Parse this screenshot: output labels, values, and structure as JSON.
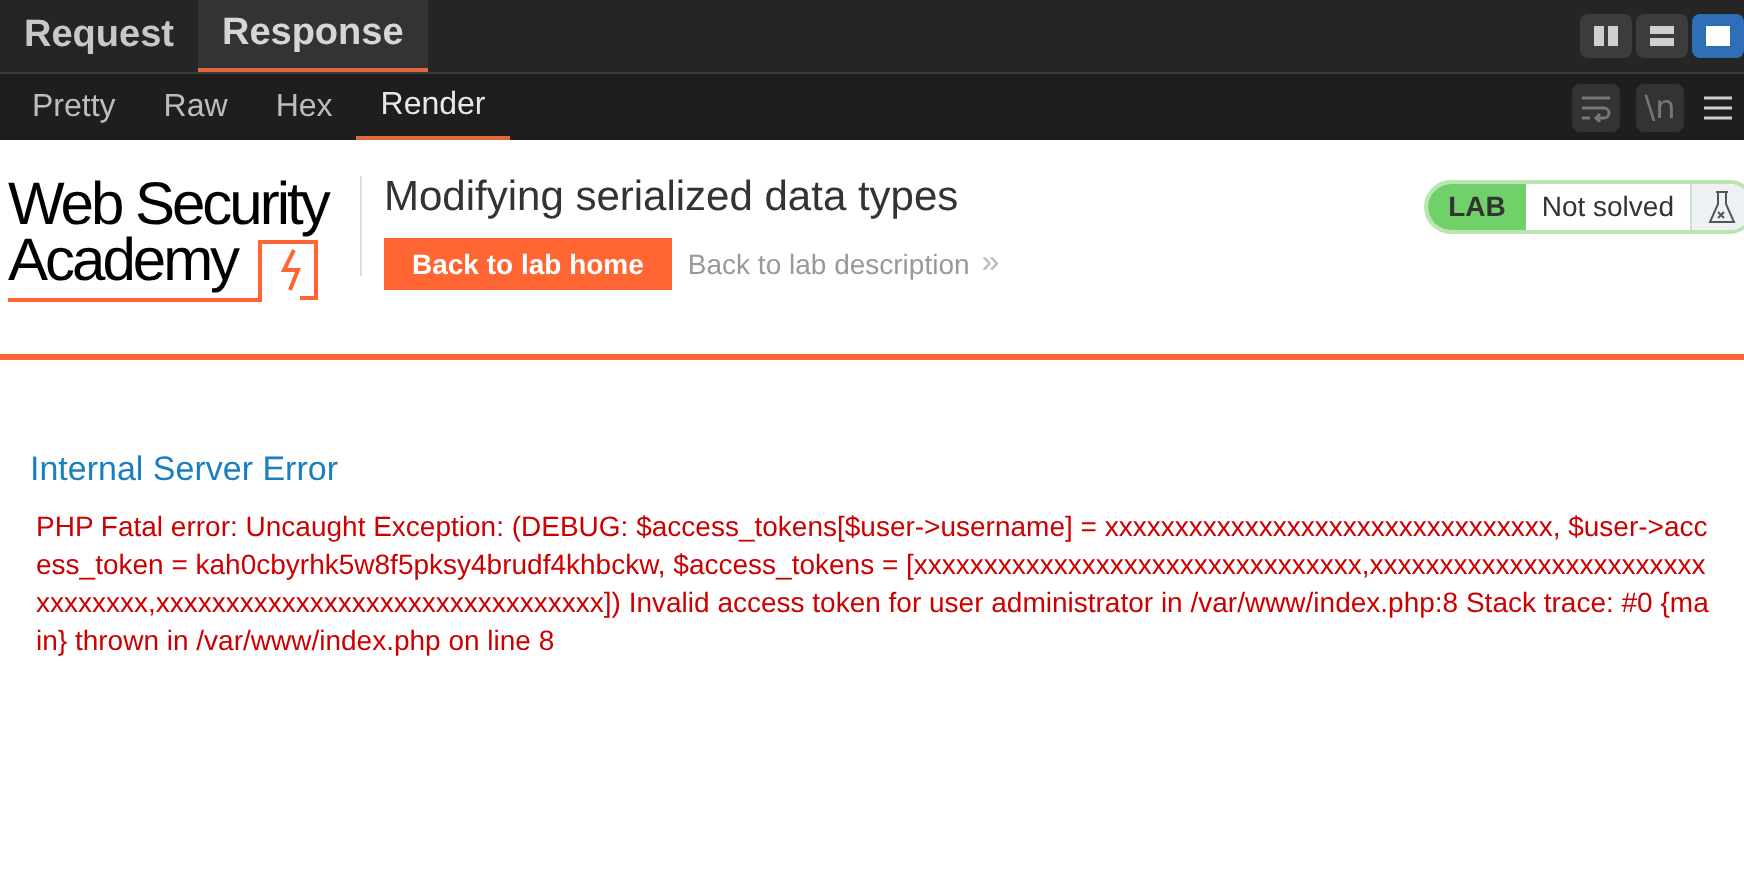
{
  "main_tabs": [
    {
      "label": "Request",
      "selected": false
    },
    {
      "label": "Response",
      "selected": true
    }
  ],
  "view_buttons": [
    {
      "kind": "columns",
      "selected": false
    },
    {
      "kind": "rows",
      "selected": false
    },
    {
      "kind": "single",
      "selected": true
    }
  ],
  "sub_tabs": [
    {
      "label": "Pretty",
      "selected": false
    },
    {
      "label": "Raw",
      "selected": false
    },
    {
      "label": "Hex",
      "selected": false
    },
    {
      "label": "Render",
      "selected": true
    }
  ],
  "toolbar_buttons": [
    {
      "kind": "wrap",
      "disabled": true
    },
    {
      "kind": "newline",
      "label": "\\n",
      "disabled": true
    },
    {
      "kind": "menu",
      "disabled": false
    }
  ],
  "page": {
    "logo": {
      "line1": "Web Security",
      "line2": "Academy"
    },
    "title": "Modifying serialized data types",
    "home_button": "Back to lab home",
    "description_link": "Back to lab description",
    "link_chevron": "»",
    "status": {
      "tag": "LAB",
      "text": "Not solved",
      "solved": false
    },
    "error_heading": "Internal Server Error",
    "error_message": "PHP Fatal error: Uncaught Exception: (DEBUG: $access_tokens[$user->username] = xxxxxxxxxxxxxxxxxxxxxxxxxxxxxxxx, $user->access_token = kah0cbyrhk5w8f5pksy4brudf4khbckw, $access_tokens = [xxxxxxxxxxxxxxxxxxxxxxxxxxxxxxxx,xxxxxxxxxxxxxxxxxxxxxxxxxxxxxxxx,xxxxxxxxxxxxxxxxxxxxxxxxxxxxxxxx]) Invalid access token for user administrator in /var/www/index.php:8 Stack trace: #0 {main} thrown in /var/www/index.php on line 8"
  }
}
